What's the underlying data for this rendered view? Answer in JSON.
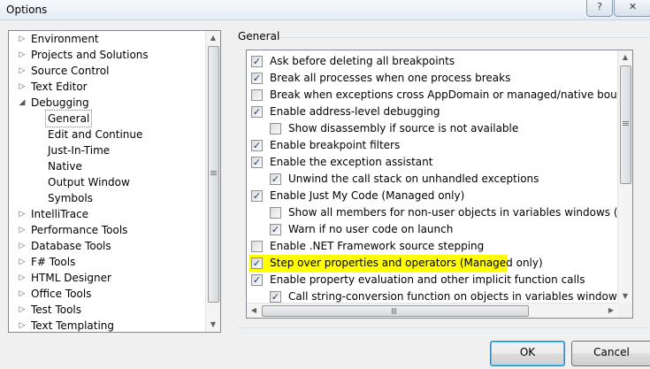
{
  "window": {
    "title": "Options",
    "help_glyph": "?",
    "close_glyph": "✕"
  },
  "tree": {
    "items": [
      {
        "label": "Environment",
        "level": 0,
        "state": "collapsed"
      },
      {
        "label": "Projects and Solutions",
        "level": 0,
        "state": "collapsed"
      },
      {
        "label": "Source Control",
        "level": 0,
        "state": "collapsed"
      },
      {
        "label": "Text Editor",
        "level": 0,
        "state": "collapsed"
      },
      {
        "label": "Debugging",
        "level": 0,
        "state": "expanded"
      },
      {
        "label": "General",
        "level": 1,
        "state": "selected"
      },
      {
        "label": "Edit and Continue",
        "level": 1,
        "state": "leaf"
      },
      {
        "label": "Just-In-Time",
        "level": 1,
        "state": "leaf"
      },
      {
        "label": "Native",
        "level": 1,
        "state": "leaf"
      },
      {
        "label": "Output Window",
        "level": 1,
        "state": "leaf"
      },
      {
        "label": "Symbols",
        "level": 1,
        "state": "leaf"
      },
      {
        "label": "IntelliTrace",
        "level": 0,
        "state": "collapsed"
      },
      {
        "label": "Performance Tools",
        "level": 0,
        "state": "collapsed"
      },
      {
        "label": "Database Tools",
        "level": 0,
        "state": "collapsed"
      },
      {
        "label": "F# Tools",
        "level": 0,
        "state": "collapsed"
      },
      {
        "label": "HTML Designer",
        "level": 0,
        "state": "collapsed"
      },
      {
        "label": "Office Tools",
        "level": 0,
        "state": "collapsed"
      },
      {
        "label": "Test Tools",
        "level": 0,
        "state": "collapsed"
      },
      {
        "label": "Text Templating",
        "level": 0,
        "state": "collapsed"
      }
    ]
  },
  "general": {
    "heading": "General",
    "options": [
      {
        "label": "Ask before deleting all breakpoints",
        "checked": true,
        "indent": 0
      },
      {
        "label": "Break all processes when one process breaks",
        "checked": true,
        "indent": 0
      },
      {
        "label": "Break when exceptions cross AppDomain or managed/native boundaries (M",
        "checked": false,
        "indent": 0
      },
      {
        "label": "Enable address-level debugging",
        "checked": true,
        "indent": 0
      },
      {
        "label": "Show disassembly if source is not available",
        "checked": false,
        "indent": 1
      },
      {
        "label": "Enable breakpoint filters",
        "checked": true,
        "indent": 0
      },
      {
        "label": "Enable the exception assistant",
        "checked": true,
        "indent": 0
      },
      {
        "label": "Unwind the call stack on unhandled exceptions",
        "checked": true,
        "indent": 1
      },
      {
        "label": "Enable Just My Code (Managed only)",
        "checked": true,
        "indent": 0
      },
      {
        "label": "Show all members for non-user objects in variables windows (Visual Ba",
        "checked": false,
        "indent": 1
      },
      {
        "label": "Warn if no user code on launch",
        "checked": true,
        "indent": 1
      },
      {
        "label": "Enable .NET Framework source stepping",
        "checked": false,
        "indent": 0
      },
      {
        "label": "Step over properties and operators (Managed only)",
        "checked": true,
        "indent": 0,
        "highlight": "#ffff00"
      },
      {
        "label": "Enable property evaluation and other implicit function calls",
        "checked": true,
        "indent": 0
      },
      {
        "label": "Call string-conversion function on objects in variables windows",
        "checked": true,
        "indent": 1
      }
    ]
  },
  "buttons": {
    "ok": "OK",
    "cancel": "Cancel"
  },
  "glyphs": {
    "check": "✓",
    "collapsed": "▷",
    "expanded": "◢",
    "up": "▲",
    "down": "▼",
    "left": "◀",
    "right": "▶"
  },
  "colors": {
    "highlight": "#ffff00",
    "ok_focus": "#47c3f8"
  }
}
